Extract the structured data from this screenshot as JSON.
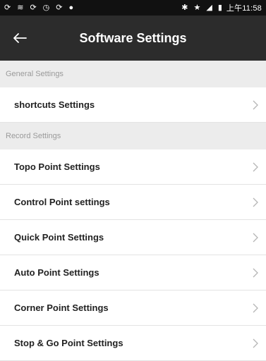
{
  "status_bar": {
    "time": "上午11:58"
  },
  "app_bar": {
    "title": "Software Settings"
  },
  "sections": [
    {
      "header": "General Settings",
      "items": [
        "shortcuts Settings"
      ]
    },
    {
      "header": "Record Settings",
      "items": [
        "Topo Point Settings",
        "Control Point settings",
        "Quick Point Settings",
        "Auto Point Settings",
        "Corner Point Settings",
        "Stop & Go Point Settings"
      ]
    }
  ],
  "colors": {
    "status_bar_bg": "#111111",
    "app_bar_bg": "#2c2c2c",
    "section_header_bg": "#ececec",
    "section_header_text": "#9a9a9a",
    "item_text": "#222222",
    "divider": "#e3e3e3",
    "chevron": "#b5b5b5"
  },
  "icons": {
    "status_left": [
      "sync-icon",
      "wifi-icon",
      "sync-icon",
      "timer-icon",
      "sync-icon",
      "location-icon"
    ],
    "status_right": [
      "bluetooth-icon",
      "star-icon",
      "no-signal-icon",
      "battery-icon"
    ],
    "app_bar": "back-arrow-icon",
    "list_item": "chevron-right-icon"
  }
}
